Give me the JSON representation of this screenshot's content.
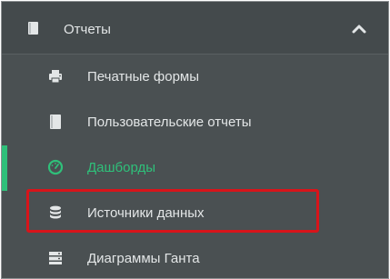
{
  "menu": {
    "section_title": "Отчеты",
    "section_icon": "book-icon",
    "collapse_icon": "chevron-up-icon",
    "items": [
      {
        "label": "Печатные формы",
        "icon": "printer-icon",
        "active": false,
        "highlighted": false
      },
      {
        "label": "Пользовательские отчеты",
        "icon": "book-icon",
        "active": false,
        "highlighted": false
      },
      {
        "label": "Дашборды",
        "icon": "dashboard-gauge-icon",
        "active": true,
        "highlighted": false
      },
      {
        "label": "Источники данных",
        "icon": "database-icon",
        "active": false,
        "highlighted": true
      },
      {
        "label": "Диаграммы Ганта",
        "icon": "server-stack-icon",
        "active": false,
        "highlighted": false
      }
    ]
  },
  "colors": {
    "background": "#4a5052",
    "header_background": "#444a4c",
    "text": "#e3e6e7",
    "accent": "#2fc07a",
    "highlight": "#d8141a"
  }
}
